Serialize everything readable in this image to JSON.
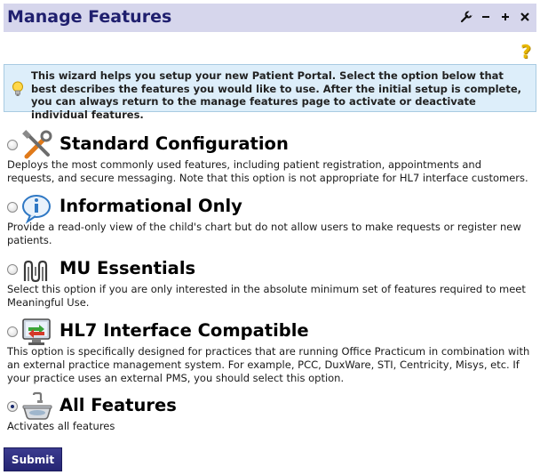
{
  "header": {
    "title": "Manage Features",
    "controls": [
      {
        "name": "wrench-icon",
        "glyph": "⚒"
      },
      {
        "name": "minimize-icon",
        "glyph": "−"
      },
      {
        "name": "maximize-icon",
        "glyph": "+"
      },
      {
        "name": "close-icon",
        "glyph": "✖"
      }
    ]
  },
  "help": {
    "glyph": "?"
  },
  "info": {
    "text": "This wizard helps you setup your new Patient Portal. Select the option below that best describes the features you would like to use. After the initial setup is complete, you can always return to the manage features page to activate or deactivate individual features."
  },
  "options": [
    {
      "label": "Standard Configuration",
      "description": "Deploys the most commonly used features, including patient registration, appointments and requests, and secure messaging. Note that this option is not appropriate for HL7 interface customers.",
      "icon": "tools-icon",
      "checked": false
    },
    {
      "label": "Informational Only",
      "description": "Provide a read-only view of the child's chart but do not allow users to make requests or register new patients.",
      "icon": "info-icon",
      "checked": false
    },
    {
      "label": "MU Essentials",
      "description": "Select this option if you are only interested in the absolute minimum set of features required to meet Meaningful Use.",
      "icon": "mu-logo-icon",
      "checked": false
    },
    {
      "label": "HL7 Interface Compatible",
      "description": "This option is specifically designed for practices that are running Office Practicum in combination with an external practice management system. For example, PCC, DuxWare, STI, Centricity, Misys, etc. If your practice uses an external PMS, you should select this option.",
      "icon": "monitor-arrows-icon",
      "checked": false
    },
    {
      "label": "All Features",
      "description": "Activates all features",
      "icon": "kitchen-sink-icon",
      "checked": true
    }
  ],
  "submit_label": "Submit"
}
